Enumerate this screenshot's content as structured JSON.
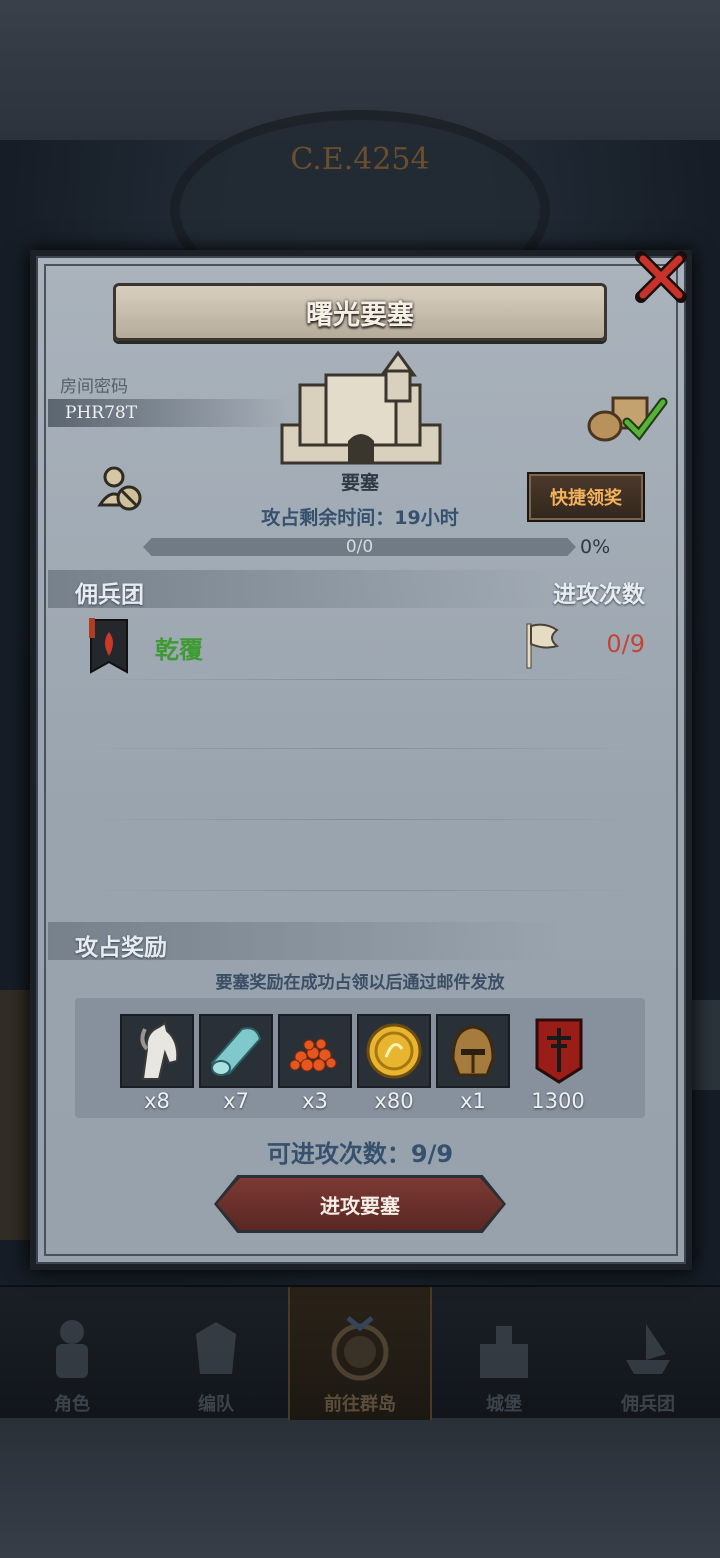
{
  "background": {
    "era": "C.E.4254"
  },
  "dialog": {
    "title": "曙光要塞",
    "room_code_label": "房间密码",
    "room_code": "PHR78T",
    "fortress_label": "要塞",
    "quick_claim_button": "快捷领奖",
    "remaining_time": "攻占剩余时间：19小时",
    "progress": {
      "text": "0/0",
      "percent_text": "0%",
      "fraction": 0.0
    },
    "guild_section": {
      "title": "佣兵团",
      "attack_count_header": "进攻次数",
      "rows": [
        {
          "name": "乾覆",
          "attacks": "0/9"
        }
      ]
    },
    "reward_section": {
      "title": "攻占奖励",
      "note": "要塞奖励在成功占领以后通过邮件发放",
      "items": [
        {
          "icon": "horse-icon",
          "qty": "x8"
        },
        {
          "icon": "cloth-icon",
          "qty": "x7"
        },
        {
          "icon": "caviar-icon",
          "qty": "x3"
        },
        {
          "icon": "gold-coin-icon",
          "qty": "x80"
        },
        {
          "icon": "helmet-icon",
          "qty": "x1"
        },
        {
          "icon": "guild-emblem-icon",
          "qty": "1300"
        }
      ]
    },
    "attempts_left": "可进攻次数：9/9",
    "attack_button": "进攻要塞"
  },
  "nav": {
    "items": [
      {
        "label": "角色",
        "active": false
      },
      {
        "label": "编队",
        "active": false
      },
      {
        "label": "前往群岛",
        "active": true
      },
      {
        "label": "城堡",
        "active": false
      },
      {
        "label": "佣兵团",
        "active": false
      }
    ]
  },
  "colors": {
    "guild_name": "#3e9a32",
    "attack_count": "#c24536",
    "quick_button_text": "#f2b15a",
    "attack_button": "#7c3a34"
  }
}
